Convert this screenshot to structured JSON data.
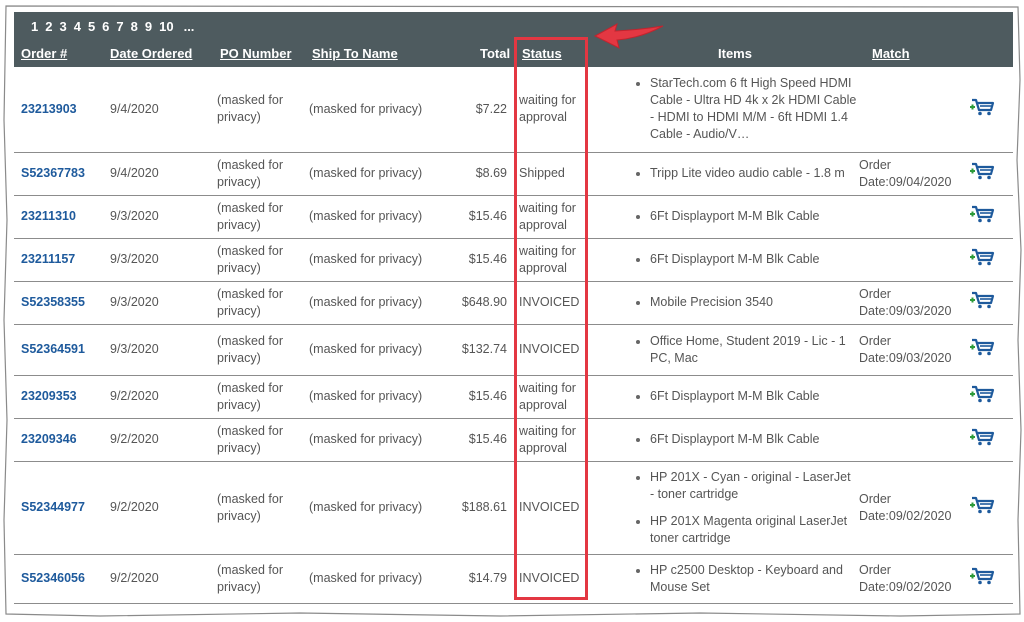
{
  "pagination": {
    "pages": [
      "1",
      "2",
      "3",
      "4",
      "5",
      "6",
      "7",
      "8",
      "9",
      "10"
    ],
    "more": "..."
  },
  "columns": {
    "order": "Order #",
    "date": "Date Ordered",
    "po": "PO Number",
    "ship": "Ship To Name",
    "total": "Total",
    "status": "Status",
    "items": "Items",
    "match": "Match"
  },
  "rows": [
    {
      "order": "23213903",
      "date": "9/4/2020",
      "po": "(masked for privacy)",
      "ship": "(masked for privacy)",
      "total": "$7.22",
      "status": "waiting for approval",
      "items": [
        "StarTech.com 6 ft High Speed HDMI Cable - Ultra HD 4k x 2k HDMI Cable - HDMI to HDMI M/M - 6ft HDMI 1.4 Cable - Audio/V…"
      ],
      "match": ""
    },
    {
      "order": "S52367783",
      "date": "9/4/2020",
      "po": "(masked for privacy)",
      "ship": "(masked for privacy)",
      "total": "$8.69",
      "status": "Shipped",
      "items": [
        "Tripp Lite video audio cable - 1.8 m"
      ],
      "match": "Order Date:09/04/2020"
    },
    {
      "order": "23211310",
      "date": "9/3/2020",
      "po": "(masked for privacy)",
      "ship": "(masked for privacy)",
      "total": "$15.46",
      "status": "waiting for approval",
      "items": [
        "6Ft Displayport M-M Blk Cable"
      ],
      "match": ""
    },
    {
      "order": "23211157",
      "date": "9/3/2020",
      "po": "(masked for privacy)",
      "ship": "(masked for privacy)",
      "total": "$15.46",
      "status": "waiting for approval",
      "items": [
        "6Ft Displayport M-M Blk Cable"
      ],
      "match": ""
    },
    {
      "order": "S52358355",
      "date": "9/3/2020",
      "po": "(masked for privacy)",
      "ship": "(masked for privacy)",
      "total": "$648.90",
      "status": "INVOICED",
      "items": [
        "Mobile Precision 3540"
      ],
      "match": "Order Date:09/03/2020"
    },
    {
      "order": "S52364591",
      "date": "9/3/2020",
      "po": "(masked for privacy)",
      "ship": "(masked for privacy)",
      "total": "$132.74",
      "status": "INVOICED",
      "items": [
        "Office Home, Student 2019 - Lic - 1 PC, Mac"
      ],
      "match": "Order Date:09/03/2020"
    },
    {
      "order": "23209353",
      "date": "9/2/2020",
      "po": "(masked for privacy)",
      "ship": "(masked for privacy)",
      "total": "$15.46",
      "status": "waiting for approval",
      "items": [
        "6Ft Displayport M-M Blk Cable"
      ],
      "match": ""
    },
    {
      "order": "23209346",
      "date": "9/2/2020",
      "po": "(masked for privacy)",
      "ship": "(masked for privacy)",
      "total": "$15.46",
      "status": "waiting for approval",
      "items": [
        "6Ft Displayport M-M Blk Cable"
      ],
      "match": ""
    },
    {
      "order": "S52344977",
      "date": "9/2/2020",
      "po": "(masked for privacy)",
      "ship": "(masked for privacy)",
      "total": "$188.61",
      "status": "INVOICED",
      "items": [
        "HP 201X - Cyan - original - LaserJet - toner cartridge",
        "HP 201X Magenta original LaserJet toner cartridge"
      ],
      "match": "Order Date:09/02/2020"
    },
    {
      "order": "S52346056",
      "date": "9/2/2020",
      "po": "(masked for privacy)",
      "ship": "(masked for privacy)",
      "total": "$14.79",
      "status": "INVOICED",
      "items": [
        "HP c2500 Desktop - Keyboard and Mouse Set"
      ],
      "match": "Order Date:09/02/2020"
    }
  ],
  "colors": {
    "header_bg": "#4e5b5f",
    "link": "#1e5a9c",
    "highlight": "#e33742",
    "cart_icon": "#1e5a9c",
    "cart_plus": "#2e9b3a"
  },
  "icons": {
    "cart": "add-to-cart-icon",
    "annotation_arrow": "arrow-icon"
  }
}
